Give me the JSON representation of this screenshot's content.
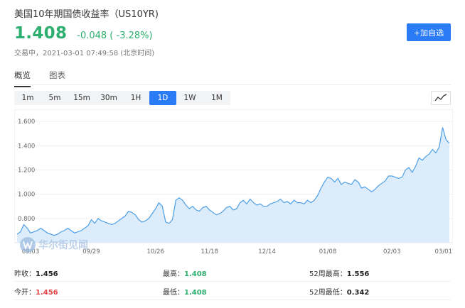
{
  "header": {
    "title": "美国10年期国债收益率（US10YR)",
    "price": "1.408",
    "change": "-0.048 ( -3.28%)",
    "status": "交易中，",
    "timestamp": "2021-03-01 07:49:58 (北京时间)",
    "watch_label": "+加自选"
  },
  "tabs": [
    {
      "label": "概览"
    },
    {
      "label": "图表"
    }
  ],
  "periods": [
    {
      "label": "1m"
    },
    {
      "label": "5m"
    },
    {
      "label": "15m"
    },
    {
      "label": "30m"
    },
    {
      "label": "1H"
    },
    {
      "label": "1D"
    },
    {
      "label": "1W"
    },
    {
      "label": "1M"
    }
  ],
  "watermark": {
    "text": "华尔街见闻"
  },
  "stats": {
    "prev_close": {
      "label": "昨收：",
      "value": "1.456"
    },
    "open": {
      "label": "今开：",
      "value": "1.456"
    },
    "high": {
      "label": "最高：",
      "value": "1.408"
    },
    "low": {
      "label": "最低：",
      "value": "1.408"
    },
    "high_52w": {
      "label": "52周最高：",
      "value": "1.556"
    },
    "low_52w": {
      "label": "52周最低：",
      "value": "0.342"
    }
  },
  "colors": {
    "accent": "#2a7cf6",
    "down": "#2eaf6f",
    "up": "#e04848",
    "line": "#4d9fe6",
    "area": "#dcecfa"
  },
  "chart_data": {
    "type": "area",
    "ylim": [
      0.6,
      1.7
    ],
    "yticks": [
      0.8,
      1.0,
      1.2,
      1.4,
      1.6
    ],
    "ytick_labels": [
      "0.800",
      "1.000",
      "1.200",
      "1.400",
      "1.600"
    ],
    "xtick_labels": [
      "09/03",
      "09/29",
      "10/26",
      "11/18",
      "12/14",
      "01/08",
      "02/03",
      "03/01"
    ],
    "xtick_index": [
      4,
      22,
      41,
      57,
      74,
      92,
      111,
      128
    ],
    "values": [
      0.67,
      0.69,
      0.75,
      0.72,
      0.68,
      0.69,
      0.7,
      0.72,
      0.7,
      0.68,
      0.67,
      0.66,
      0.67,
      0.69,
      0.7,
      0.72,
      0.7,
      0.68,
      0.69,
      0.7,
      0.72,
      0.74,
      0.79,
      0.76,
      0.8,
      0.78,
      0.77,
      0.76,
      0.75,
      0.76,
      0.78,
      0.8,
      0.82,
      0.86,
      0.85,
      0.83,
      0.79,
      0.77,
      0.78,
      0.8,
      0.84,
      0.88,
      0.93,
      0.9,
      0.77,
      0.76,
      0.79,
      0.95,
      0.97,
      0.95,
      0.91,
      0.88,
      0.9,
      0.87,
      0.86,
      0.89,
      0.9,
      0.87,
      0.85,
      0.83,
      0.84,
      0.86,
      0.89,
      0.9,
      0.87,
      0.88,
      0.93,
      0.95,
      0.92,
      0.96,
      0.93,
      0.91,
      0.92,
      0.9,
      0.9,
      0.92,
      0.93,
      0.94,
      0.96,
      0.93,
      0.94,
      0.92,
      0.95,
      0.93,
      0.93,
      0.92,
      0.95,
      0.93,
      0.95,
      0.99,
      1.05,
      1.1,
      1.14,
      1.13,
      1.1,
      1.13,
      1.08,
      1.1,
      1.09,
      1.08,
      1.12,
      1.1,
      1.05,
      1.06,
      1.04,
      1.02,
      1.04,
      1.07,
      1.09,
      1.11,
      1.15,
      1.15,
      1.14,
      1.13,
      1.14,
      1.2,
      1.22,
      1.18,
      1.23,
      1.3,
      1.28,
      1.31,
      1.33,
      1.37,
      1.34,
      1.39,
      1.55,
      1.45,
      1.42
    ]
  }
}
